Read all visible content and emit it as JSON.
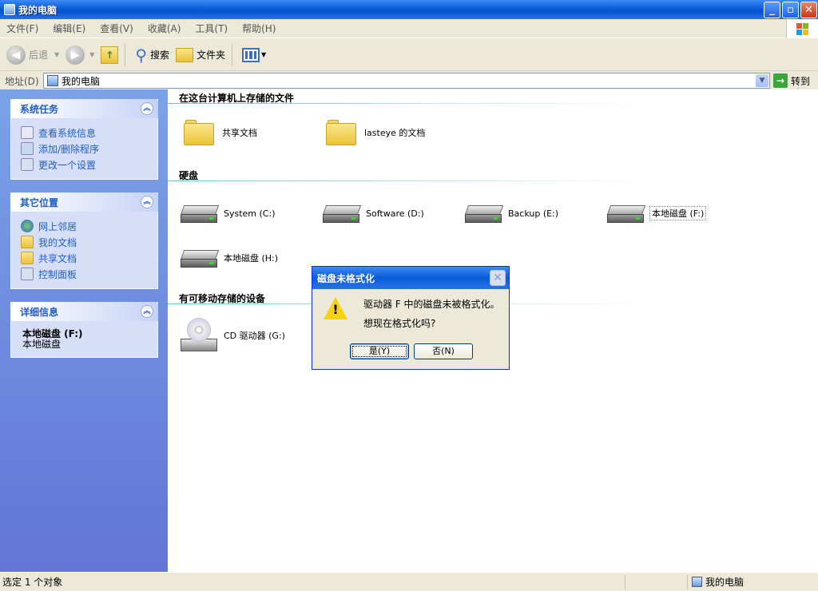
{
  "window": {
    "title": "我的电脑",
    "min_label": "_",
    "max_label": "▫",
    "close_label": "✕"
  },
  "menu": [
    "文件(F)",
    "编辑(E)",
    "查看(V)",
    "收藏(A)",
    "工具(T)",
    "帮助(H)"
  ],
  "toolbar": {
    "back": "后退",
    "search": "搜索",
    "folders": "文件夹"
  },
  "address": {
    "label": "地址(D)",
    "value": "我的电脑",
    "go": "转到"
  },
  "sidebar": {
    "system_tasks": {
      "title": "系统任务",
      "items": [
        "查看系统信息",
        "添加/删除程序",
        "更改一个设置"
      ]
    },
    "other_places": {
      "title": "其它位置",
      "items": [
        "网上邻居",
        "我的文档",
        "共享文档",
        "控制面板"
      ]
    },
    "details": {
      "title": "详细信息",
      "name": "本地磁盘 (F:)",
      "type": "本地磁盘"
    }
  },
  "sections": {
    "files": {
      "title": "在这台计算机上存储的文件",
      "items": [
        "共享文档",
        "lasteye 的文档"
      ]
    },
    "hdd": {
      "title": "硬盘",
      "items": [
        "System (C:)",
        "Software (D:)",
        "Backup (E:)",
        "本地磁盘 (F:)",
        "本地磁盘 (H:)"
      ]
    },
    "removable": {
      "title": "有可移动存储的设备",
      "items": [
        "CD 驱动器 (G:)"
      ]
    }
  },
  "status": {
    "left": "选定 1 个对象",
    "right": "我的电脑"
  },
  "dialog": {
    "title": "磁盘未格式化",
    "line1": "驱动器 F 中的磁盘未被格式化。",
    "line2": "想现在格式化吗?",
    "yes": "是(Y)",
    "no": "否(N)"
  }
}
